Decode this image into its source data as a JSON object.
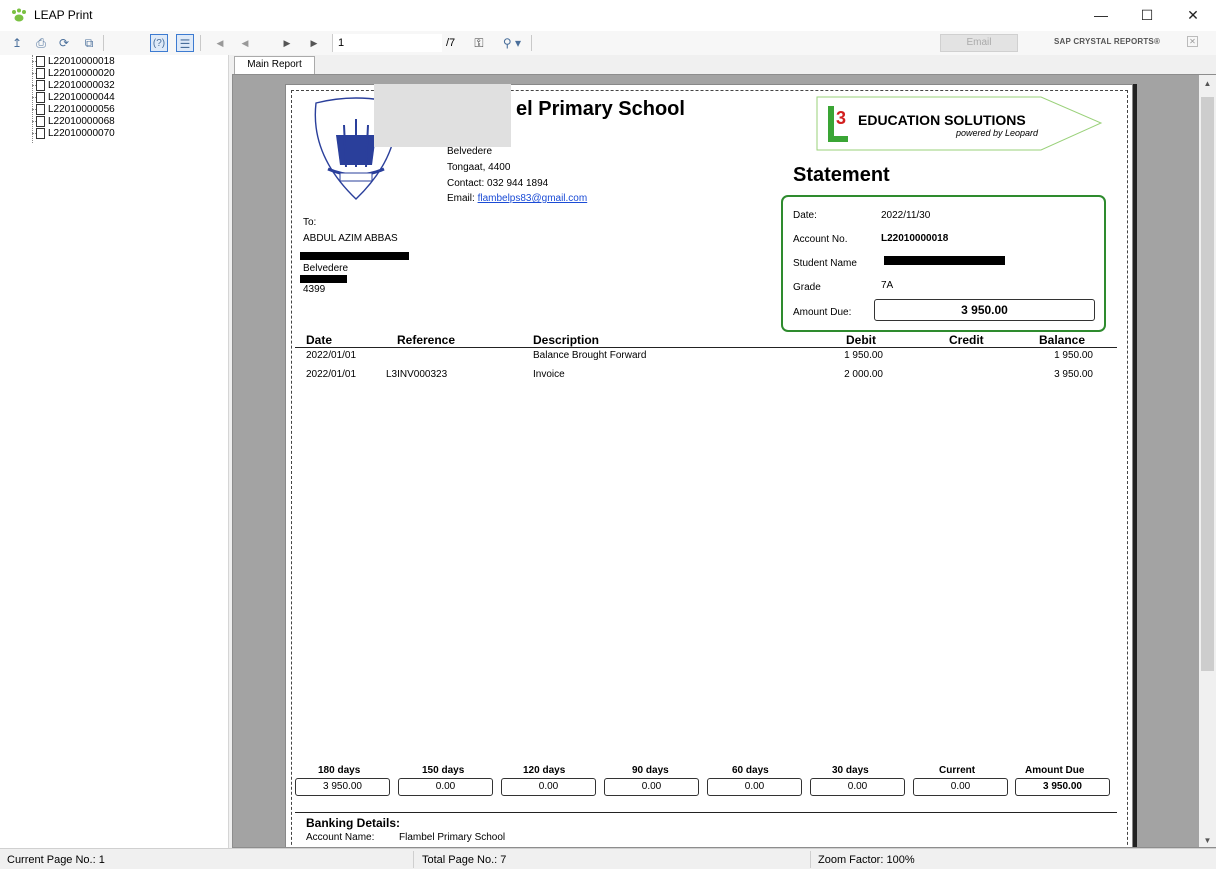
{
  "window": {
    "title": "LEAP Print"
  },
  "toolbar": {
    "page_number": "1",
    "page_total": "/7",
    "email_label": "Email",
    "brand": "SAP CRYSTAL REPORTS®"
  },
  "tree": {
    "items": [
      "L22010000018",
      "L22010000020",
      "L22010000032",
      "L22010000044",
      "L22010000056",
      "L22010000068",
      "L22010000070"
    ]
  },
  "tabs": {
    "main_report": "Main Report"
  },
  "report": {
    "school_name": "el Primary School",
    "school_address_1": "Belvedere",
    "school_address_2": "Tongaat, 4400",
    "contact": "Contact: 032 944 1894",
    "email_prefix": "Email: ",
    "email": "flambelps83@gmail.com",
    "logo_text": "EDUCATION SOLUTIONS",
    "logo_sub": "powered by Leopard",
    "logo_mark": "3",
    "statement_title": "Statement",
    "to_label": "To:",
    "recipient_name": "ABDUL AZIM ABBAS",
    "recipient_line_3": "Belvedere",
    "recipient_postcode": "4399",
    "account": {
      "date_label": "Date:",
      "date": "2022/11/30",
      "account_no_label": "Account No.",
      "account_no": "L22010000018",
      "student_name_label": "Student Name",
      "grade_label": "Grade",
      "grade": "7A",
      "amount_due_label": "Amount Due:",
      "amount_due": "3 950.00"
    },
    "columns": {
      "date": "Date",
      "reference": "Reference",
      "description": "Description",
      "debit": "Debit",
      "credit": "Credit",
      "balance": "Balance"
    },
    "rows": [
      {
        "date": "2022/01/01",
        "reference": "",
        "description": "Balance Brought Forward",
        "debit": "1 950.00",
        "credit": "",
        "balance": "1 950.00"
      },
      {
        "date": "2022/01/01",
        "reference": "L3INV000323",
        "description": "Invoice",
        "debit": "2 000.00",
        "credit": "",
        "balance": "3 950.00"
      }
    ],
    "aging": {
      "labels": [
        "180 days",
        "150 days",
        "120 days",
        "90 days",
        "60 days",
        "30 days",
        "Current",
        "Amount Due"
      ],
      "values": [
        "3 950.00",
        "0.00",
        "0.00",
        "0.00",
        "0.00",
        "0.00",
        "0.00",
        "3 950.00"
      ]
    },
    "banking_title": "Banking Details:",
    "account_name_label": "Account Name:",
    "account_name": "Flambel Primary School"
  },
  "status": {
    "current_page": "Current Page No.: 1",
    "total_pages": "Total Page No.: 7",
    "zoom": "Zoom Factor: 100%"
  },
  "colors": {
    "accent": "#2e8b2e",
    "link": "#1a4bd6",
    "viewer_bg": "#a3a3a3"
  }
}
